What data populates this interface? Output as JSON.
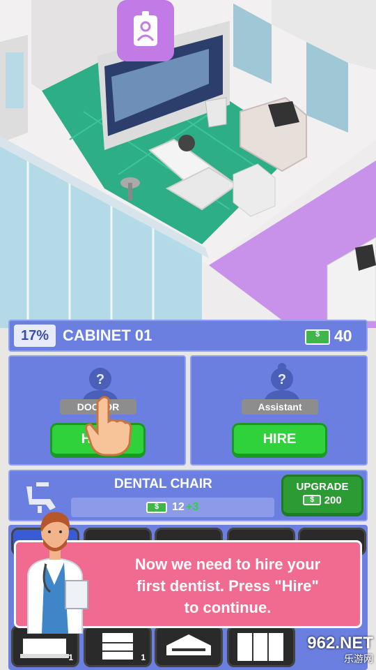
{
  "cabinet": {
    "percent": "17%",
    "name": "CABINET 01",
    "coins": "40"
  },
  "staff": {
    "doctor": {
      "question": "?",
      "role_label": "DOCTOR",
      "hire_label": "HIRE"
    },
    "assistant": {
      "question": "?",
      "role_label": "Assistant",
      "hire_label": "HIRE"
    }
  },
  "equipment": {
    "name": "DENTAL CHAIR",
    "value": "12",
    "bonus": "+3",
    "upgrade_label": "UPGRADE",
    "upgrade_cost": "200"
  },
  "tutorial": {
    "line1": "Now we need to hire your",
    "line2": "first dentist. Press \"Hire\"",
    "line3": "to continue."
  },
  "shop_tiles": [
    {
      "count": "1"
    },
    {
      "count": "1"
    },
    {
      "count": ""
    },
    {
      "count": ""
    }
  ],
  "watermark": {
    "brand": "962.NET",
    "sub": "乐游网"
  },
  "colors": {
    "panel": "#6b7fe0",
    "green": "#2fd23a",
    "floor": "#2eae86",
    "tutorial": "#f06b8f"
  }
}
